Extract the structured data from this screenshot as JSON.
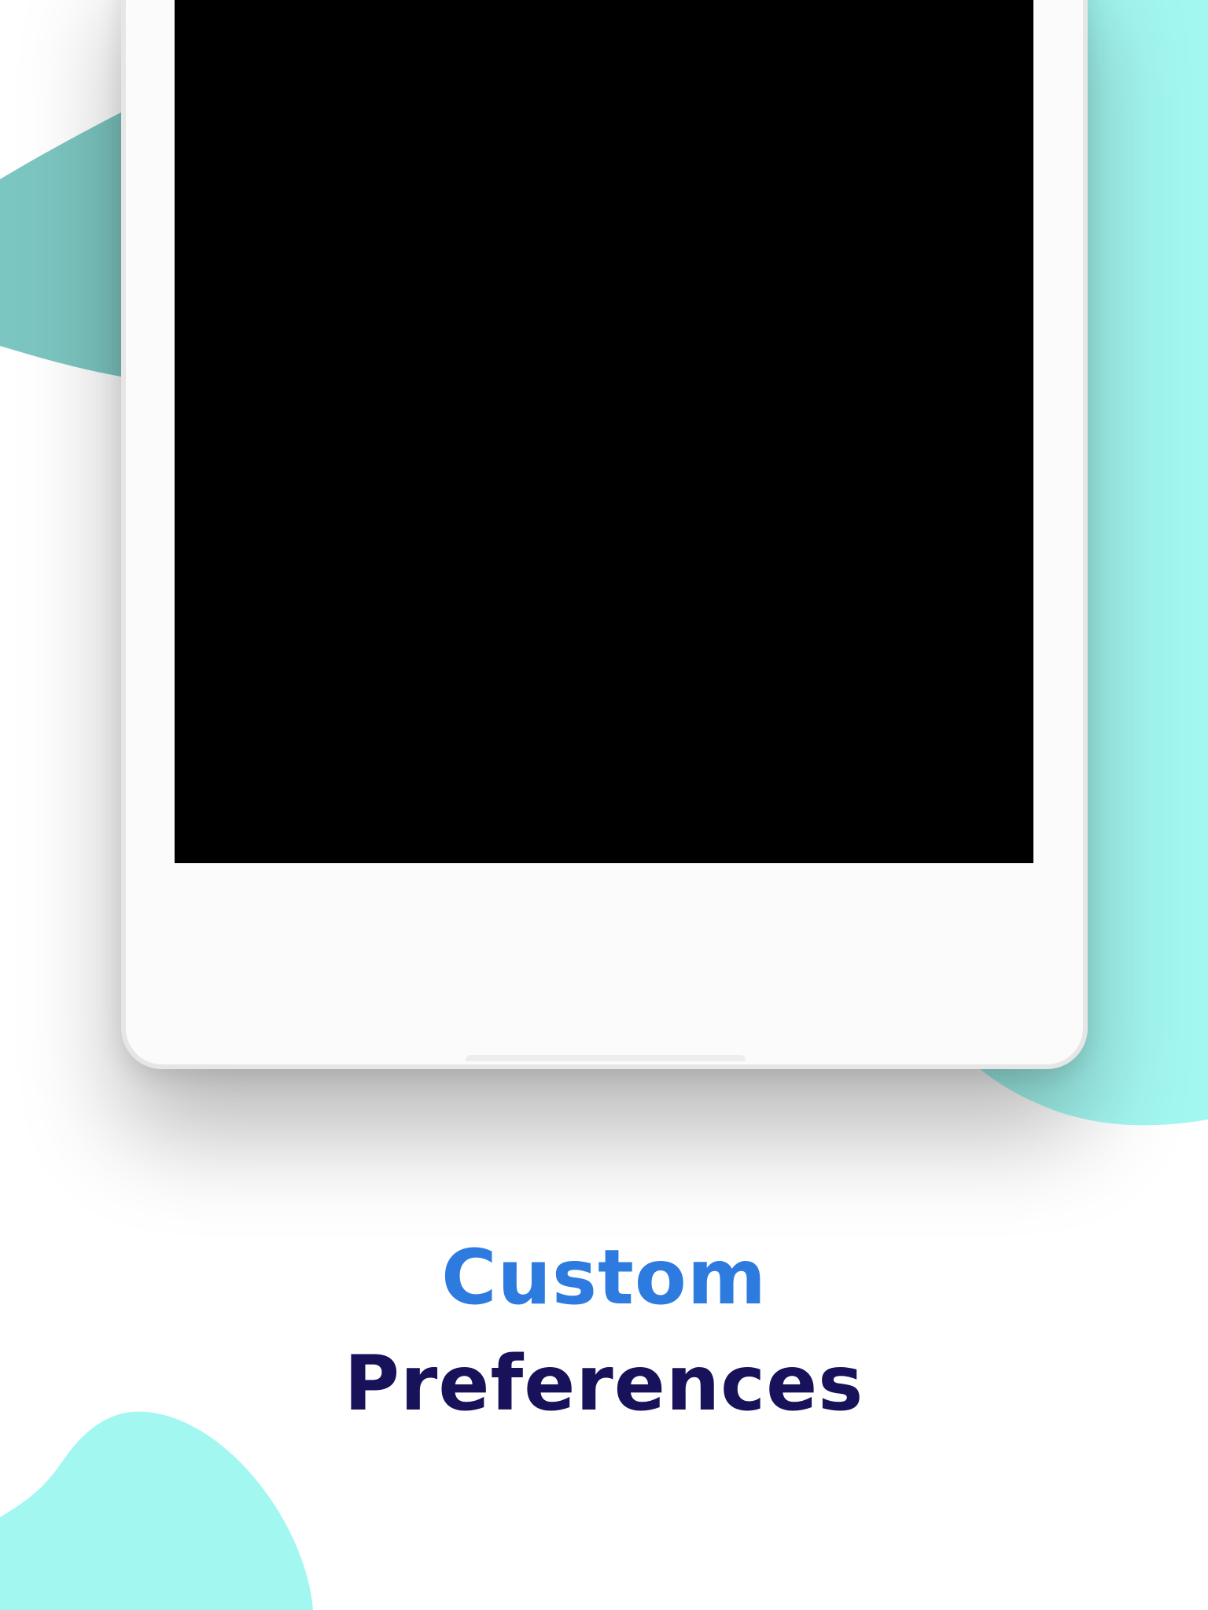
{
  "caption": {
    "line1": "Custom",
    "line2": "Preferences"
  },
  "colors": {
    "background": "#ffffff",
    "accent_shape": "#a3f7f1",
    "accent_shape_left": "#7cc6c1",
    "device_body": "#fbfbfb",
    "device_border": "#e6e6e6",
    "screen": "#000000",
    "caption_line1": "#2e7be0",
    "caption_line2": "#17125a"
  },
  "icons": {
    "decorative_blob": "blob-shape"
  }
}
